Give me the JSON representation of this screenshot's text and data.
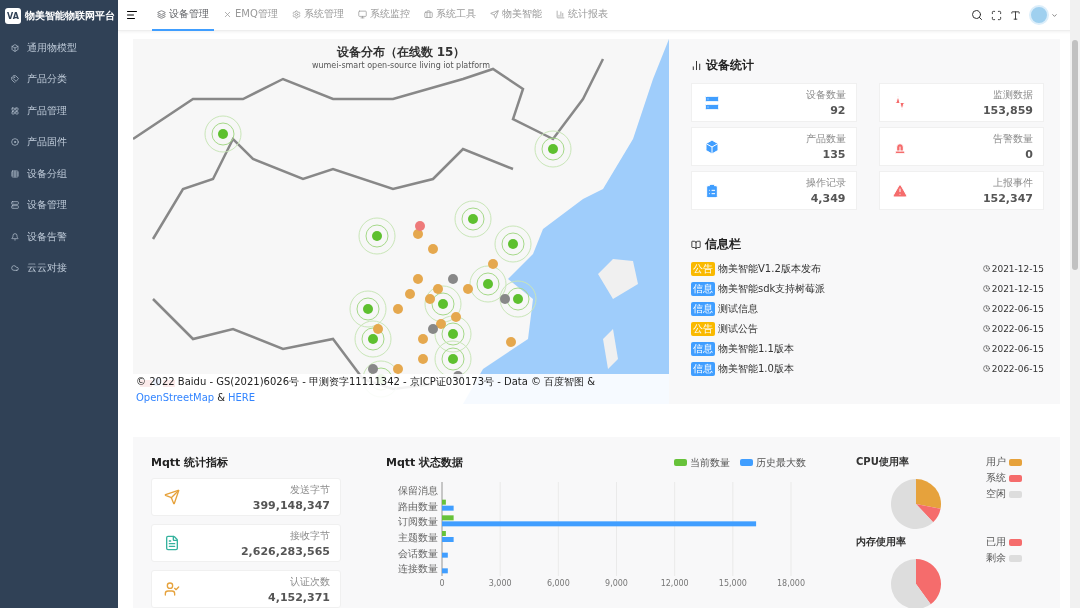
{
  "sidebar": {
    "logo_mark": "VA",
    "logo_text": "物美智能物联网平台",
    "items": [
      {
        "label": "通用物模型",
        "kind": "model"
      },
      {
        "label": "产品分类",
        "kind": "category"
      },
      {
        "label": "产品管理",
        "kind": "product"
      },
      {
        "label": "产品固件",
        "kind": "firmware"
      },
      {
        "label": "设备分组",
        "kind": "group"
      },
      {
        "label": "设备管理",
        "kind": "device"
      },
      {
        "label": "设备告警",
        "kind": "alert"
      },
      {
        "label": "云云对接",
        "kind": "cloud"
      }
    ]
  },
  "topbar": {
    "tabs": [
      {
        "label": "设备管理",
        "kind": "device",
        "selected": true
      },
      {
        "label": "EMQ管理",
        "kind": "emq",
        "selected": false
      },
      {
        "label": "系统管理",
        "kind": "system",
        "selected": false
      },
      {
        "label": "系统监控",
        "kind": "monitor",
        "selected": false
      },
      {
        "label": "系统工具",
        "kind": "tool",
        "selected": false
      },
      {
        "label": "物美智能",
        "kind": "smart",
        "selected": false
      },
      {
        "label": "统计报表",
        "kind": "report",
        "selected": false
      }
    ]
  },
  "map_panel": {
    "title": "设备分布（在线数 15）",
    "subtitle": "wumei-smart open-source living iot platform",
    "attribution": "© 2022 Baidu - GS(2021)6026号 - 甲测资字11111342 - 京ICP证030173号 - Data © 百度智图 &",
    "links": [
      "OpenStreetMap",
      "HERE"
    ],
    "link_separator": "&"
  },
  "device_stats": {
    "title": "设备统计",
    "cards": [
      {
        "label": "设备数量",
        "value": "92",
        "kind": "server",
        "color": "#409eff"
      },
      {
        "label": "监测数据",
        "value": "153,859",
        "kind": "monitor",
        "color": "#f56c6c"
      },
      {
        "label": "产品数量",
        "value": "135",
        "kind": "box",
        "color": "#409eff"
      },
      {
        "label": "告警数量",
        "value": "0",
        "kind": "alarm",
        "color": "#f56c6c"
      },
      {
        "label": "操作记录",
        "value": "4,349",
        "kind": "clipboard",
        "color": "#409eff"
      },
      {
        "label": "上报事件",
        "value": "152,347",
        "kind": "warning",
        "color": "#f56c6c"
      }
    ]
  },
  "info": {
    "title": "信息栏",
    "items": [
      {
        "tag": "公告",
        "kind": "notice",
        "title": "物美智能V1.2版本发布",
        "date": "2021-12-15"
      },
      {
        "tag": "信息",
        "kind": "info",
        "title": "物美智能sdk支持树莓派",
        "date": "2021-12-15"
      },
      {
        "tag": "信息",
        "kind": "info",
        "title": "测试信息",
        "date": "2022-06-15"
      },
      {
        "tag": "公告",
        "kind": "notice",
        "title": "测试公告",
        "date": "2022-06-15"
      },
      {
        "tag": "信息",
        "kind": "info",
        "title": "物美智能1.1版本",
        "date": "2022-06-15"
      },
      {
        "tag": "信息",
        "kind": "info",
        "title": "物美智能1.0版本",
        "date": "2022-06-15"
      }
    ]
  },
  "mqtt_stats": {
    "title": "Mqtt 统计指标",
    "cards": [
      {
        "label": "发送字节",
        "value": "399,148,347",
        "kind": "send"
      },
      {
        "label": "接收字节",
        "value": "2,626,283,565",
        "kind": "receive"
      },
      {
        "label": "认证次数",
        "value": "4,152,371",
        "kind": "auth"
      }
    ]
  },
  "mqtt_status": {
    "title": "Mqtt 状态数据",
    "chart_data": {
      "type": "bar",
      "orientation": "horizontal",
      "categories": [
        "保留消息",
        "路由数量",
        "订阅数量",
        "主题数量",
        "会话数量",
        "连接数量"
      ],
      "series": [
        {
          "name": "当前数量",
          "color": "#67c23a",
          "values": [
            0,
            200,
            600,
            200,
            0,
            0
          ]
        },
        {
          "name": "历史最大数",
          "color": "#409eff",
          "values": [
            0,
            600,
            16200,
            600,
            300,
            300
          ]
        }
      ],
      "xlim": [
        0,
        18000
      ],
      "grid": true,
      "xticks": [
        {
          "value": 0,
          "label": "0"
        },
        {
          "value": 3000,
          "label": "3,000"
        },
        {
          "value": 6000,
          "label": "6,000"
        },
        {
          "value": 9000,
          "label": "9,000"
        },
        {
          "value": 12000,
          "label": "12,000"
        },
        {
          "value": 15000,
          "label": "15,000"
        },
        {
          "value": 18000,
          "label": "18,000"
        }
      ]
    }
  },
  "cpu": {
    "title": "CPU使用率",
    "legend": [
      {
        "label": "用户",
        "color": "#e6a23c"
      },
      {
        "label": "系统",
        "color": "#f56c6c"
      },
      {
        "label": "空闲",
        "color": "#dddddd"
      }
    ]
  },
  "memory": {
    "title": "内存使用率",
    "legend": [
      {
        "label": "已用",
        "color": "#f56c6c"
      },
      {
        "label": "剩余",
        "color": "#dddddd"
      }
    ]
  }
}
